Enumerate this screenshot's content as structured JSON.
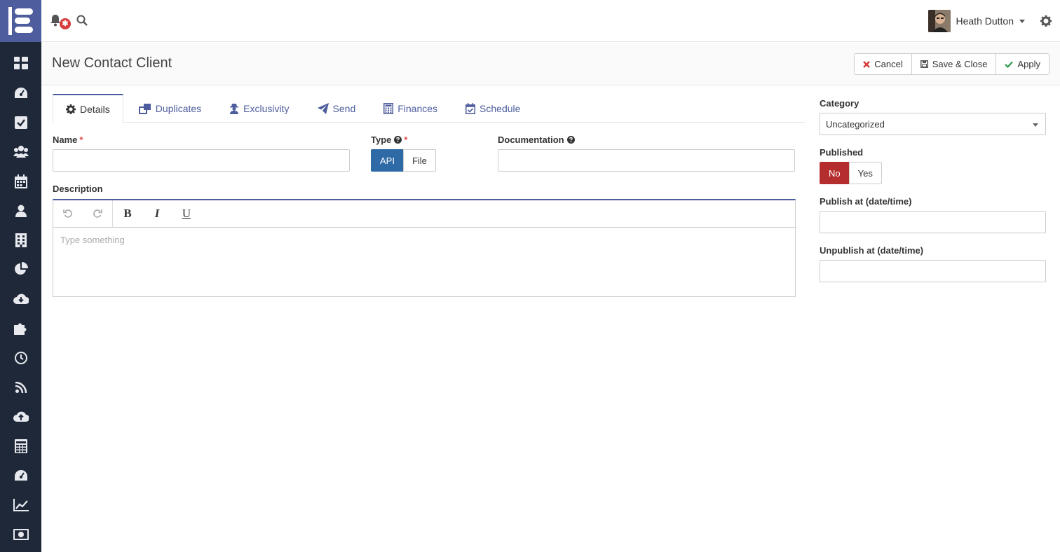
{
  "topbar": {
    "notification_badge": "✱",
    "user_name": "Heath Dutton"
  },
  "page": {
    "title": "New Contact Client"
  },
  "actions": {
    "cancel": "Cancel",
    "save_close": "Save & Close",
    "apply": "Apply"
  },
  "tabs": [
    {
      "label": "Details",
      "icon": "gear-icon"
    },
    {
      "label": "Duplicates",
      "icon": "clone-icon"
    },
    {
      "label": "Exclusivity",
      "icon": "user-secret-icon"
    },
    {
      "label": "Send",
      "icon": "paper-plane-icon"
    },
    {
      "label": "Finances",
      "icon": "calculator-icon"
    },
    {
      "label": "Schedule",
      "icon": "calendar-check-icon"
    }
  ],
  "form": {
    "name_label": "Name",
    "required_mark": "*",
    "type_label": "Type",
    "type_options": [
      "API",
      "File"
    ],
    "type_selected": "API",
    "documentation_label": "Documentation",
    "description_label": "Description",
    "description_placeholder": "Type something",
    "toolbar": {
      "bold": "B",
      "italic": "I",
      "underline": "U"
    }
  },
  "sidebar_panel": {
    "category_label": "Category",
    "category_value": "Uncategorized",
    "published_label": "Published",
    "published_options": [
      "No",
      "Yes"
    ],
    "published_selected": "No",
    "publish_at_label": "Publish at (date/time)",
    "unpublish_at_label": "Unpublish at (date/time)"
  },
  "nav_icons": [
    "dashboard-icon",
    "tachometer-icon",
    "check-square-icon",
    "users-icon",
    "calendar-icon",
    "user-icon",
    "building-icon",
    "pie-chart-icon",
    "cloud-download-icon",
    "puzzle-icon",
    "clock-icon",
    "rss-icon",
    "cloud-upload-icon",
    "table-icon",
    "gauge-icon",
    "line-chart-icon",
    "money-icon"
  ],
  "colors": {
    "sidebar": "#1f2838",
    "brand": "#4e5d9d",
    "primary": "#2e6aa6",
    "danger": "#b52e2e"
  }
}
